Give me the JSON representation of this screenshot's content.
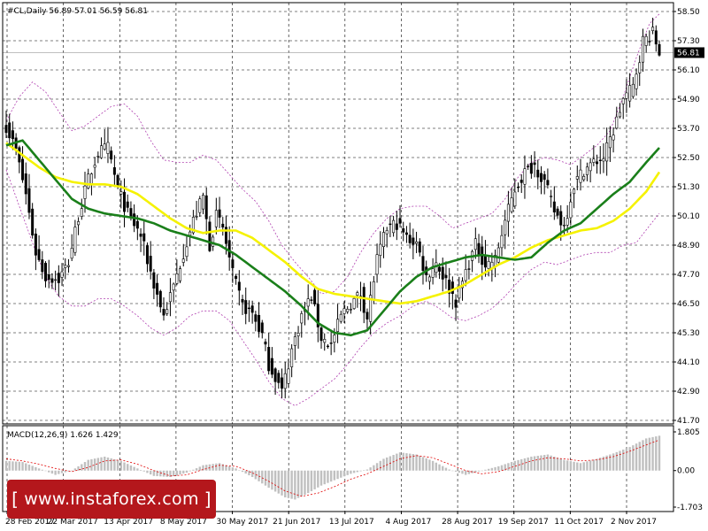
{
  "header": {
    "symbol_text": "#CL,Daily  56.89 57.01 56.59 56.81"
  },
  "macd": {
    "label": "MACD(12,26,9) 1.626 1.429"
  },
  "watermark": {
    "text": "www.instaforex.com",
    "bracket_left": "[",
    "bracket_right": "]"
  },
  "colors": {
    "candles": "#000000",
    "ma_fast": "#1a7f1a",
    "ma_slow": "#f5f200",
    "envelope": "#b040b0",
    "histogram": "#c0c0c0",
    "signal": "#e00000",
    "grid": "#000000",
    "price_tag_bg": "#000000"
  },
  "chart_data": [
    {
      "type": "candlestick",
      "title": "#CL,Daily",
      "ohlc_last": {
        "open": 56.89,
        "high": 57.01,
        "low": 56.59,
        "close": 56.81
      },
      "current_price_label": "56.81",
      "y_ticks": [
        "58.50",
        "57.30",
        "56.10",
        "54.90",
        "53.70",
        "52.50",
        "51.30",
        "50.10",
        "48.90",
        "47.70",
        "46.50",
        "45.30",
        "44.10",
        "42.90",
        "41.70"
      ],
      "ylim": [
        41.7,
        58.5
      ],
      "x_ticks": [
        "28 Feb 2017",
        "22 Mar 2017",
        "13 Apr 2017",
        "8 May 2017",
        "30 May 2017",
        "21 Jun 2017",
        "13 Jul 2017",
        "4 Aug 2017",
        "28 Aug 2017",
        "19 Sep 2017",
        "11 Oct 2017",
        "2 Nov 2017"
      ],
      "grid": true,
      "close_anchors": [
        [
          0,
          53.8
        ],
        [
          3,
          52.8
        ],
        [
          6,
          51.0
        ],
        [
          9,
          48.6
        ],
        [
          12,
          47.6
        ],
        [
          16,
          47.5
        ],
        [
          19,
          48.2
        ],
        [
          22,
          50.1
        ],
        [
          25,
          51.6
        ],
        [
          28,
          52.7
        ],
        [
          31,
          52.9
        ],
        [
          34,
          51.2
        ],
        [
          37,
          50.2
        ],
        [
          41,
          49.3
        ],
        [
          45,
          47.3
        ],
        [
          48,
          46.0
        ],
        [
          51,
          47.2
        ],
        [
          54,
          48.6
        ],
        [
          57,
          49.9
        ],
        [
          60,
          50.9
        ],
        [
          62,
          48.9
        ],
        [
          64,
          50.1
        ],
        [
          66,
          49.6
        ],
        [
          69,
          47.7
        ],
        [
          72,
          46.4
        ],
        [
          75,
          46.1
        ],
        [
          78,
          45.2
        ],
        [
          80,
          44.0
        ],
        [
          82,
          43.5
        ],
        [
          84,
          42.9
        ],
        [
          87,
          44.6
        ],
        [
          90,
          46.0
        ],
        [
          93,
          46.8
        ],
        [
          96,
          45.1
        ],
        [
          99,
          44.8
        ],
        [
          102,
          46.0
        ],
        [
          105,
          46.5
        ],
        [
          108,
          46.9
        ],
        [
          110,
          45.9
        ],
        [
          113,
          48.3
        ],
        [
          116,
          49.6
        ],
        [
          119,
          49.8
        ],
        [
          122,
          49.2
        ],
        [
          125,
          49.0
        ],
        [
          128,
          47.6
        ],
        [
          131,
          48.2
        ],
        [
          134,
          47.4
        ],
        [
          137,
          46.6
        ],
        [
          140,
          47.8
        ],
        [
          143,
          48.9
        ],
        [
          146,
          48.1
        ],
        [
          149,
          48.3
        ],
        [
          152,
          49.9
        ],
        [
          155,
          51.2
        ],
        [
          158,
          51.9
        ],
        [
          161,
          52.2
        ],
        [
          164,
          51.5
        ],
        [
          167,
          50.3
        ],
        [
          170,
          49.7
        ],
        [
          173,
          51.4
        ],
        [
          176,
          52.0
        ],
        [
          179,
          52.3
        ],
        [
          182,
          52.5
        ],
        [
          185,
          53.6
        ],
        [
          188,
          54.9
        ],
        [
          191,
          55.4
        ],
        [
          194,
          57.3
        ],
        [
          197,
          57.6
        ],
        [
          199,
          56.81
        ]
      ],
      "ma_fast_anchors": [
        [
          0,
          53.0
        ],
        [
          5,
          53.2
        ],
        [
          10,
          52.4
        ],
        [
          15,
          51.6
        ],
        [
          20,
          50.8
        ],
        [
          25,
          50.4
        ],
        [
          30,
          50.2
        ],
        [
          35,
          50.1
        ],
        [
          40,
          50.0
        ],
        [
          45,
          49.8
        ],
        [
          50,
          49.5
        ],
        [
          55,
          49.3
        ],
        [
          60,
          49.1
        ],
        [
          65,
          48.9
        ],
        [
          70,
          48.5
        ],
        [
          75,
          48.0
        ],
        [
          80,
          47.5
        ],
        [
          85,
          47.0
        ],
        [
          90,
          46.4
        ],
        [
          95,
          45.7
        ],
        [
          100,
          45.3
        ],
        [
          105,
          45.2
        ],
        [
          110,
          45.4
        ],
        [
          115,
          46.2
        ],
        [
          120,
          47.0
        ],
        [
          125,
          47.6
        ],
        [
          130,
          48.0
        ],
        [
          135,
          48.2
        ],
        [
          140,
          48.4
        ],
        [
          145,
          48.5
        ],
        [
          150,
          48.4
        ],
        [
          155,
          48.3
        ],
        [
          160,
          48.4
        ],
        [
          165,
          49.0
        ],
        [
          170,
          49.5
        ],
        [
          175,
          49.8
        ],
        [
          180,
          50.4
        ],
        [
          185,
          51.0
        ],
        [
          190,
          51.5
        ],
        [
          195,
          52.3
        ],
        [
          199,
          52.9
        ]
      ],
      "ma_slow_anchors": [
        [
          0,
          53.1
        ],
        [
          5,
          52.6
        ],
        [
          10,
          52.1
        ],
        [
          15,
          51.7
        ],
        [
          20,
          51.5
        ],
        [
          25,
          51.4
        ],
        [
          30,
          51.4
        ],
        [
          35,
          51.3
        ],
        [
          40,
          51.0
        ],
        [
          45,
          50.5
        ],
        [
          50,
          50.0
        ],
        [
          55,
          49.6
        ],
        [
          60,
          49.4
        ],
        [
          65,
          49.5
        ],
        [
          70,
          49.5
        ],
        [
          75,
          49.2
        ],
        [
          80,
          48.7
        ],
        [
          85,
          48.2
        ],
        [
          90,
          47.6
        ],
        [
          95,
          47.1
        ],
        [
          100,
          46.9
        ],
        [
          105,
          46.8
        ],
        [
          110,
          46.7
        ],
        [
          115,
          46.6
        ],
        [
          120,
          46.5
        ],
        [
          125,
          46.6
        ],
        [
          130,
          46.8
        ],
        [
          135,
          47.0
        ],
        [
          140,
          47.3
        ],
        [
          145,
          47.7
        ],
        [
          150,
          48.1
        ],
        [
          155,
          48.4
        ],
        [
          160,
          48.8
        ],
        [
          165,
          49.1
        ],
        [
          170,
          49.3
        ],
        [
          175,
          49.5
        ],
        [
          180,
          49.6
        ],
        [
          185,
          49.9
        ],
        [
          190,
          50.4
        ],
        [
          195,
          51.1
        ],
        [
          199,
          51.9
        ]
      ],
      "envelope_upper_anchors": [
        [
          0,
          54.0
        ],
        [
          4,
          55.0
        ],
        [
          8,
          55.6
        ],
        [
          12,
          55.2
        ],
        [
          16,
          54.4
        ],
        [
          20,
          53.6
        ],
        [
          24,
          53.8
        ],
        [
          28,
          54.2
        ],
        [
          32,
          54.6
        ],
        [
          36,
          54.7
        ],
        [
          40,
          54.2
        ],
        [
          44,
          53.2
        ],
        [
          48,
          52.4
        ],
        [
          52,
          52.3
        ],
        [
          56,
          52.3
        ],
        [
          60,
          52.6
        ],
        [
          64,
          52.4
        ],
        [
          68,
          51.8
        ],
        [
          72,
          51.2
        ],
        [
          76,
          50.7
        ],
        [
          80,
          49.9
        ],
        [
          84,
          48.9
        ],
        [
          88,
          48.2
        ],
        [
          92,
          47.6
        ],
        [
          96,
          46.9
        ],
        [
          100,
          47.0
        ],
        [
          104,
          47.6
        ],
        [
          108,
          48.6
        ],
        [
          112,
          49.4
        ],
        [
          116,
          50.0
        ],
        [
          120,
          50.4
        ],
        [
          124,
          50.5
        ],
        [
          128,
          50.5
        ],
        [
          132,
          50.1
        ],
        [
          136,
          49.6
        ],
        [
          140,
          49.8
        ],
        [
          144,
          50.0
        ],
        [
          148,
          50.2
        ],
        [
          152,
          50.8
        ],
        [
          156,
          51.7
        ],
        [
          160,
          52.3
        ],
        [
          164,
          52.5
        ],
        [
          168,
          52.4
        ],
        [
          172,
          52.2
        ],
        [
          176,
          52.6
        ],
        [
          180,
          53.0
        ],
        [
          184,
          53.6
        ],
        [
          188,
          55.0
        ],
        [
          192,
          56.6
        ],
        [
          196,
          58.0
        ],
        [
          199,
          58.4
        ]
      ],
      "envelope_lower_anchors": [
        [
          0,
          52.0
        ],
        [
          4,
          50.5
        ],
        [
          8,
          49.0
        ],
        [
          12,
          47.6
        ],
        [
          16,
          46.8
        ],
        [
          20,
          46.4
        ],
        [
          24,
          46.4
        ],
        [
          28,
          46.7
        ],
        [
          32,
          46.7
        ],
        [
          36,
          46.4
        ],
        [
          40,
          46.0
        ],
        [
          44,
          45.5
        ],
        [
          48,
          45.2
        ],
        [
          52,
          45.5
        ],
        [
          56,
          46.0
        ],
        [
          60,
          46.2
        ],
        [
          64,
          46.2
        ],
        [
          68,
          45.8
        ],
        [
          72,
          45.0
        ],
        [
          76,
          44.2
        ],
        [
          80,
          43.3
        ],
        [
          84,
          42.6
        ],
        [
          88,
          42.3
        ],
        [
          92,
          42.6
        ],
        [
          96,
          43.0
        ],
        [
          100,
          43.4
        ],
        [
          104,
          44.0
        ],
        [
          108,
          44.7
        ],
        [
          112,
          45.3
        ],
        [
          116,
          45.7
        ],
        [
          120,
          46.0
        ],
        [
          124,
          46.4
        ],
        [
          128,
          46.6
        ],
        [
          132,
          46.3
        ],
        [
          136,
          45.9
        ],
        [
          140,
          45.8
        ],
        [
          144,
          46.0
        ],
        [
          148,
          46.3
        ],
        [
          152,
          46.8
        ],
        [
          156,
          47.4
        ],
        [
          160,
          47.9
        ],
        [
          164,
          48.2
        ],
        [
          168,
          48.1
        ],
        [
          172,
          48.3
        ],
        [
          176,
          48.5
        ],
        [
          180,
          48.6
        ],
        [
          184,
          48.6
        ],
        [
          188,
          48.9
        ],
        [
          192,
          49.0
        ],
        [
          196,
          49.7
        ],
        [
          199,
          50.2
        ]
      ]
    },
    {
      "type": "bar",
      "title": "MACD(12,26,9)",
      "macd_value": 1.626,
      "signal_value": 1.429,
      "y_ticks": [
        "1.805",
        "0.00",
        "-1.703"
      ],
      "ylim": [
        -1.703,
        1.805
      ],
      "histogram_anchors": [
        [
          0,
          0.45
        ],
        [
          5,
          0.4
        ],
        [
          10,
          0.1
        ],
        [
          15,
          -0.2
        ],
        [
          20,
          0.0
        ],
        [
          25,
          0.5
        ],
        [
          30,
          0.65
        ],
        [
          35,
          0.45
        ],
        [
          40,
          0.1
        ],
        [
          45,
          -0.25
        ],
        [
          50,
          -0.3
        ],
        [
          55,
          -0.1
        ],
        [
          60,
          0.25
        ],
        [
          65,
          0.35
        ],
        [
          70,
          0.1
        ],
        [
          75,
          -0.3
        ],
        [
          80,
          -0.8
        ],
        [
          85,
          -1.25
        ],
        [
          88,
          -1.35
        ],
        [
          92,
          -1.05
        ],
        [
          96,
          -0.7
        ],
        [
          100,
          -0.45
        ],
        [
          105,
          -0.15
        ],
        [
          110,
          0.05
        ],
        [
          115,
          0.55
        ],
        [
          120,
          0.85
        ],
        [
          125,
          0.75
        ],
        [
          130,
          0.45
        ],
        [
          135,
          0.05
        ],
        [
          140,
          -0.2
        ],
        [
          145,
          0.0
        ],
        [
          150,
          0.2
        ],
        [
          155,
          0.45
        ],
        [
          160,
          0.65
        ],
        [
          165,
          0.75
        ],
        [
          170,
          0.5
        ],
        [
          175,
          0.35
        ],
        [
          180,
          0.55
        ],
        [
          185,
          0.8
        ],
        [
          190,
          1.1
        ],
        [
          195,
          1.5
        ],
        [
          199,
          1.626
        ]
      ],
      "signal_anchors": [
        [
          0,
          0.55
        ],
        [
          5,
          0.45
        ],
        [
          10,
          0.3
        ],
        [
          15,
          0.1
        ],
        [
          20,
          -0.05
        ],
        [
          25,
          0.15
        ],
        [
          30,
          0.45
        ],
        [
          35,
          0.5
        ],
        [
          40,
          0.3
        ],
        [
          45,
          0.0
        ],
        [
          50,
          -0.25
        ],
        [
          55,
          -0.2
        ],
        [
          60,
          0.05
        ],
        [
          65,
          0.25
        ],
        [
          70,
          0.2
        ],
        [
          75,
          -0.1
        ],
        [
          80,
          -0.5
        ],
        [
          85,
          -0.95
        ],
        [
          90,
          -1.2
        ],
        [
          95,
          -1.05
        ],
        [
          100,
          -0.75
        ],
        [
          105,
          -0.4
        ],
        [
          110,
          -0.15
        ],
        [
          115,
          0.2
        ],
        [
          120,
          0.55
        ],
        [
          125,
          0.7
        ],
        [
          130,
          0.6
        ],
        [
          135,
          0.3
        ],
        [
          140,
          0.0
        ],
        [
          145,
          -0.15
        ],
        [
          150,
          -0.05
        ],
        [
          155,
          0.2
        ],
        [
          160,
          0.45
        ],
        [
          165,
          0.6
        ],
        [
          170,
          0.55
        ],
        [
          175,
          0.45
        ],
        [
          180,
          0.5
        ],
        [
          185,
          0.65
        ],
        [
          190,
          0.9
        ],
        [
          195,
          1.2
        ],
        [
          199,
          1.429
        ]
      ]
    }
  ]
}
